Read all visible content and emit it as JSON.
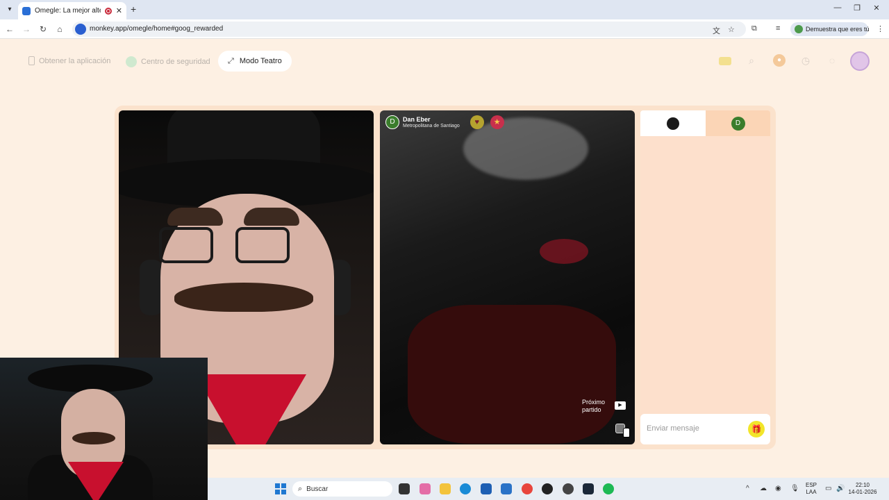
{
  "browser": {
    "tab_title": "Omegle: La mejor alternati",
    "url": "monkey.app/omegle/home#goog_rewarded",
    "verify_label": "Demuestra que eres tú"
  },
  "site_nav": {
    "get_app": "Obtener la aplicación",
    "safety_center": "Centro de seguridad",
    "theatre_mode": "Modo Teatro"
  },
  "remote_user": {
    "initial": "D",
    "name": "Dan Eber",
    "location": "Metropolitana de Santiago"
  },
  "controls": {
    "next_match": "Próximo partido"
  },
  "chat": {
    "them_initial": "D",
    "input_placeholder": "Enviar mensaje"
  },
  "taskbar": {
    "search_label": "Buscar",
    "lang_line1": "ESP",
    "lang_line2": "LAA",
    "time": "22:10",
    "date": "14-01-2026"
  },
  "colors": {
    "page_bg": "#fdf0e3",
    "stage_bg": "#fbe2cc",
    "chat_bg": "#fde0cc",
    "user_avatar": "#3a7d2c",
    "gift": "#f2e52a"
  },
  "icons": [
    "chevron-down-icon",
    "close-icon",
    "plus-icon",
    "back-icon",
    "forward-icon",
    "reload-icon",
    "home-icon",
    "translate-icon",
    "star-icon",
    "extensions-icon",
    "media-icon",
    "menu-icon",
    "phone-icon",
    "shield-icon",
    "expand-icon",
    "chest-icon",
    "search-icon",
    "coin-icon",
    "history-icon",
    "chat-icon",
    "gift-icon",
    "youtube-icon",
    "report-icon",
    "windows-icon"
  ]
}
